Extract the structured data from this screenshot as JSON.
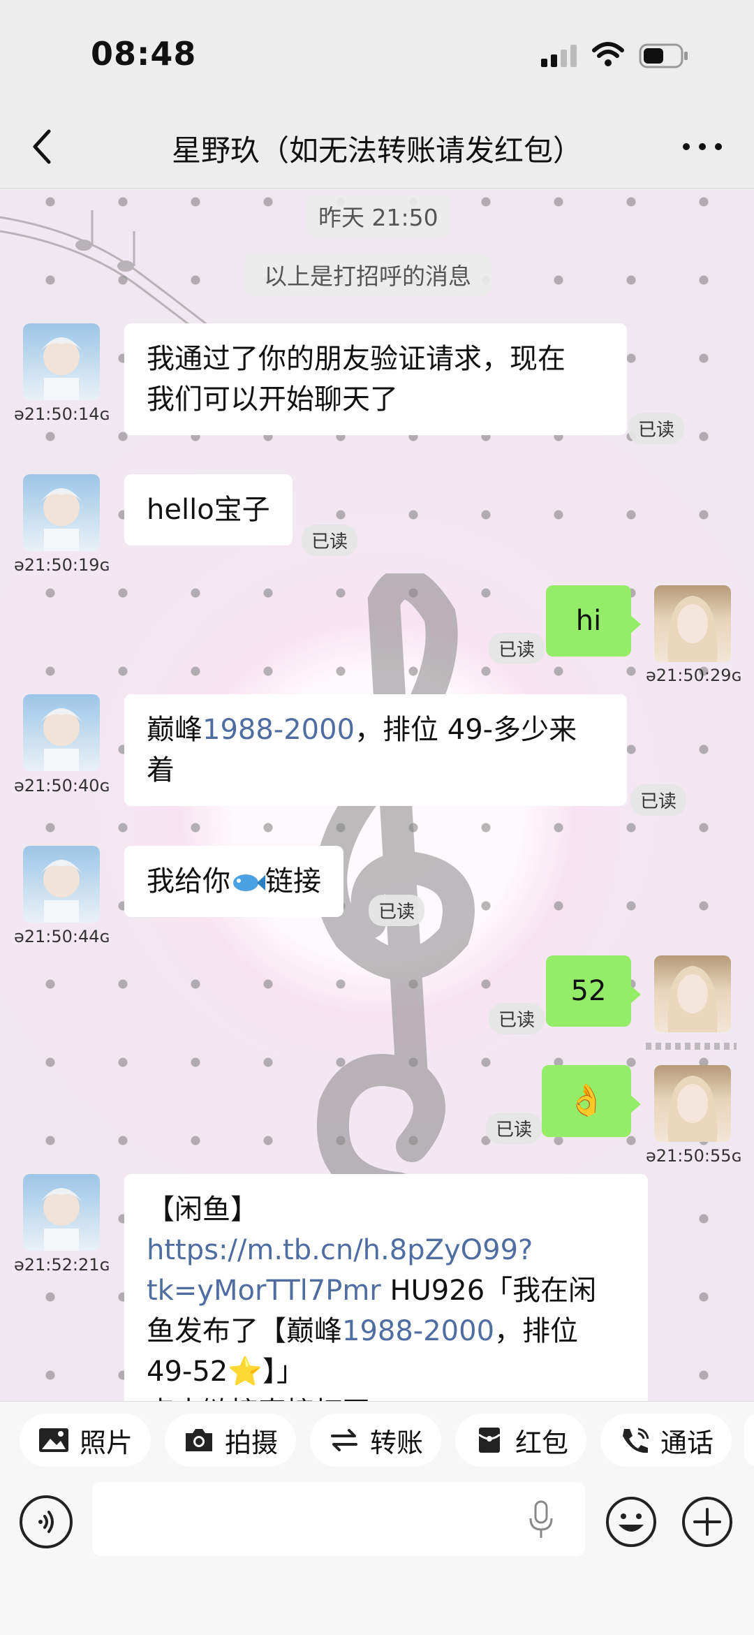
{
  "status_bar": {
    "time": "08:48"
  },
  "header": {
    "title": "星野玖（如无法转账请发红包）"
  },
  "chat": {
    "date_label": "昨天 21:50",
    "system_notice": "以上是打招呼的消息",
    "read_label": "已读",
    "messages": [
      {
        "sender": "contact",
        "time": "21:50:14",
        "lines": [
          "我通过了你的朋友验证请求，现在",
          "我们可以开始聊天了"
        ]
      },
      {
        "sender": "contact",
        "time": "21:50:19",
        "text": "hello宝子"
      },
      {
        "sender": "me",
        "time": "21:50:29",
        "text": "hi"
      },
      {
        "sender": "contact",
        "time": "21:50:40",
        "prefix": "巅峰",
        "link": "1988-2000",
        "suffix": "，排位 49-多少来",
        "line2": "着"
      },
      {
        "sender": "contact",
        "time": "21:50:44",
        "before": "我给你",
        "after": "链接"
      },
      {
        "sender": "me",
        "time": "",
        "text": "52"
      },
      {
        "sender": "me",
        "time": "21:50:55",
        "text": "👌"
      },
      {
        "sender": "contact",
        "time": "21:52:21",
        "l1_prefix": "【闲鱼】",
        "l1_link": "https://m.tb.cn/h.8pZyO99?",
        "l2_link": "tk=yMorTTl7Pmr",
        "l2_text": " HU926「我在闲",
        "l3_prefix": "鱼发布了【巅峰",
        "l3_link": "1988-2000",
        "l3_suffix": "，排位",
        "l4_text": "49-52⭐】」",
        "l5_text": "点击链接直接打开"
      }
    ]
  },
  "toolbar": {
    "photo": "照片",
    "camera": "拍摄",
    "transfer": "转账",
    "red_packet": "红包",
    "call": "通话"
  },
  "input": {
    "placeholder": ""
  },
  "colors": {
    "accent_green": "#95ec69",
    "link_blue": "#4f6da1",
    "bg": "#ededed"
  }
}
